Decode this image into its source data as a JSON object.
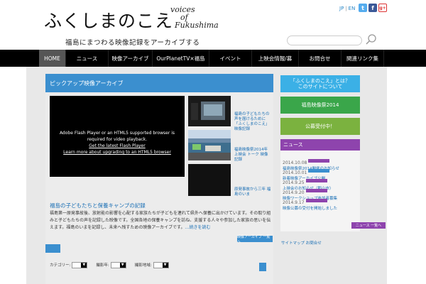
{
  "header": {
    "logo_jp": "ふくしまのこえ",
    "logo_en": [
      "voices",
      "of",
      "Fukushima"
    ],
    "tagline": "福島にまつわる映像記録をアーカイブする",
    "lang_jp": "JP",
    "lang_en": "EN",
    "search_placeholder": ""
  },
  "nav": {
    "items": [
      {
        "label": "HOME",
        "active": true
      },
      {
        "label": "ニュース"
      },
      {
        "label": "映像アーカイブ"
      },
      {
        "label": "OurPlanetTV×福島"
      },
      {
        "label": "イベント"
      },
      {
        "label": "上映会情報/募"
      },
      {
        "label": "お問合せ"
      },
      {
        "label": "関連リンク集"
      }
    ]
  },
  "main": {
    "title": "ピックアップ映像アーカイブ",
    "video": {
      "line1": "Adobe Flash Player or an HTML5 supported browser is",
      "line2": "required for video playback.",
      "link1": "Get the latest Flash Player",
      "link2": "Learn more about upgrading to an HTML5 browser"
    },
    "thumbs": [
      {
        "text": "福島の子どもたちの声を届けるために「ふくしまのこえ」映像記録"
      },
      {
        "text": "福島映像祭2014年 上映会 トーク 映像 記録"
      },
      {
        "text": "原発事故から三年 福島のいま"
      }
    ],
    "feature_title": "福島の子どもたちと保養キャンプの記録",
    "feature_body": "福島第一原発事故後、放射能の影響を心配する家族たちが子どもを連れて県外へ保養に出かけています。その取り組みと子どもたちの声を記録した映像です。全国各地の保養キャンプを訪ね、支援する人々や参加した家族の思いを伝えます。福島のいまを記録し、未来へ残すための映像アーカイブです。",
    "more_link": "…続きを読む",
    "more_button": "映像アーカイブ 一覧へ",
    "filters": [
      {
        "label": "カテゴリー:"
      },
      {
        "label": "撮影年:"
      },
      {
        "label": "撮影地域:"
      }
    ]
  },
  "sidebar": {
    "about": "「ふくしまのこえ」とは？\nこのサイトについて",
    "festival": "福島映像祭2014",
    "recruit": "公募受付中！",
    "news_header": "ニュース",
    "news": [
      {
        "date": "2014.10.08",
        "tag": "purple",
        "title": "福島映像祭2014開催のお知らせ"
      },
      {
        "date": "2014.10.01",
        "tag": "blue",
        "title": "新着映像アーカイブ公開"
      },
      {
        "date": "2014.9.25",
        "tag": "purple",
        "title": "上映会のお知らせ（郡山市）"
      },
      {
        "date": "2014.9.20",
        "tag": "purple",
        "title": "映像ワークショップ参加者募集"
      },
      {
        "date": "2014.9.17",
        "tag": "purple",
        "title": "映像公募の受付を開始しました"
      }
    ],
    "news_more": "ニュース 一覧へ",
    "footer_link": "サイトマップ お問合せ"
  },
  "colors": {
    "accent": "#3b8fcf",
    "nav_bg": "#000000",
    "news_purple": "#8e44ad",
    "festival_green": "#3aa64a",
    "recruit_green": "#7bb23f",
    "about_blue": "#3bb0e6"
  }
}
